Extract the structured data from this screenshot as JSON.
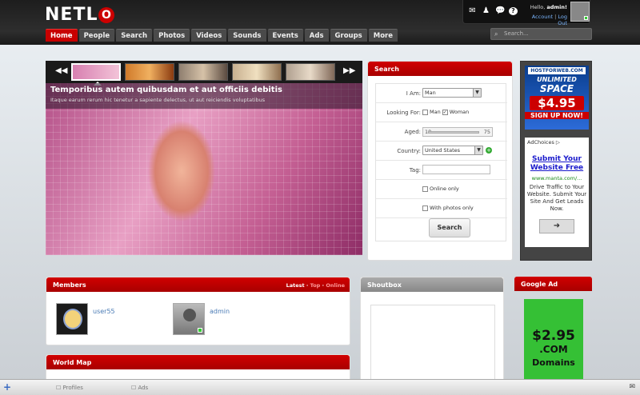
{
  "logo": {
    "text": "NETL",
    "o": "O"
  },
  "nav": {
    "tabs": [
      "Home",
      "People",
      "Search",
      "Photos",
      "Videos",
      "Sounds",
      "Events",
      "Ads",
      "Groups",
      "More"
    ]
  },
  "userbox": {
    "hello": "Hello,",
    "user": "admin!",
    "account": "Account",
    "sep": "|",
    "logout": "Log Out"
  },
  "search_top": {
    "placeholder": "Search..."
  },
  "slider": {
    "title": "Temporibus autem quibusdam et aut officiis debitis",
    "subtitle": "Itaque earum rerum hic tenetur a sapiente delectus, ut aut reiciendis voluptatibus",
    "prev": "◀◀",
    "next": "▶▶"
  },
  "search_panel": {
    "title": "Search",
    "iam_label": "I Am:",
    "iam_value": "Man",
    "looking_label": "Looking For:",
    "opt_man": "Man",
    "opt_woman": "Woman",
    "aged_label": "Aged:",
    "age_min": "18",
    "age_max": "75",
    "country_label": "Country:",
    "country_value": "United States",
    "tag_label": "Tag:",
    "online_only": "Online only",
    "with_photos": "With photos only",
    "button": "Search"
  },
  "ad_host": {
    "brand": "HOSTFORWEB.COM",
    "line1": "UNLIMITED",
    "line2": "SPACE",
    "price": "$4.95",
    "cta": "SIGN UP NOW!"
  },
  "ad_manta": {
    "adchoices": "AdChoices ▷",
    "headline": "Submit Your Website Free",
    "url": "www.manta.com/...",
    "desc": "Drive Traffic to Your Website. Submit Your Site And Get Leads Now."
  },
  "members": {
    "title": "Members",
    "tab_latest": "Latest",
    "tab_top": "Top",
    "tab_online": "Online",
    "sep": "·",
    "list": [
      {
        "name": "user55"
      },
      {
        "name": "admin"
      }
    ]
  },
  "worldmap": {
    "title": "World Map"
  },
  "shoutbox": {
    "title": "Shoutbox"
  },
  "google_ad": {
    "title": "Google Ad",
    "price": "$2.95",
    "com": ".COM",
    "domains": "Domains"
  },
  "bottombar": {
    "profiles": "Profiles",
    "ads": "Ads"
  },
  "colors": {
    "accent": "#c80000",
    "header": "#222222",
    "link": "#4a7bb5"
  }
}
